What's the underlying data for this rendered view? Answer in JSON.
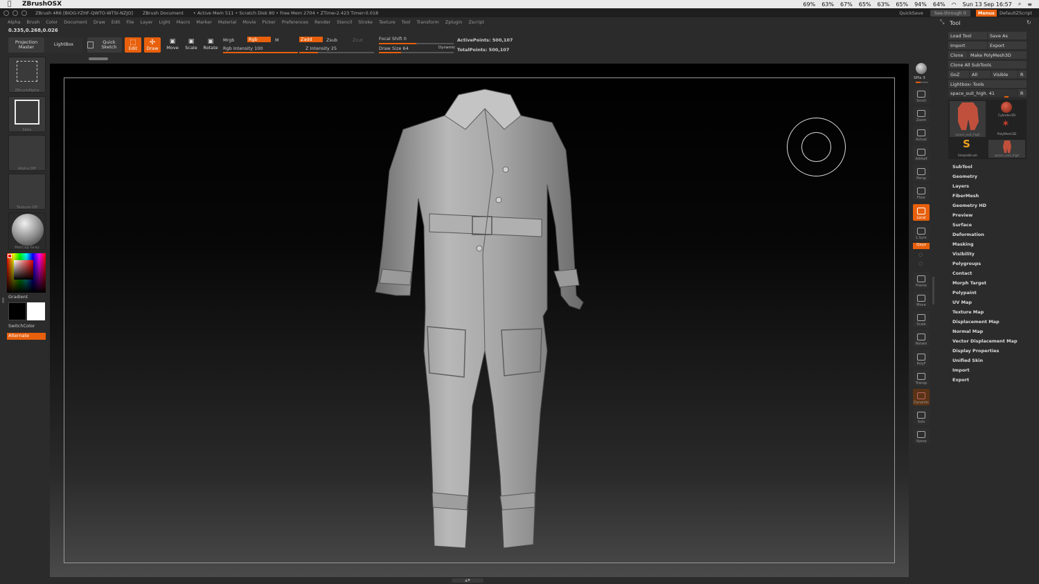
{
  "mac_menubar": {
    "app_name": "ZBrushOSX",
    "status": [
      "69%",
      "63%",
      "67%",
      "65%",
      "63%",
      "65%",
      "94%",
      "64%"
    ],
    "clock": "Sun 13 Sep 16:57"
  },
  "titlebar": {
    "version": "ZBrush 4R6 [BIOG-YZHF-QWTO-WTSI-NZJO]",
    "document": "ZBrush Document",
    "stats": "• Active Mem 511 • Scratch Disk 80 • Free Mem 2704 • ZTime›2.423 Timer›0.018",
    "quicksave": "QuickSave",
    "seethrough": "See-through  0",
    "menus": "Menus",
    "default_script": "DefaultZScript"
  },
  "menubar": [
    "Alpha",
    "Brush",
    "Color",
    "Document",
    "Draw",
    "Edit",
    "File",
    "Layer",
    "Light",
    "Macro",
    "Marker",
    "Material",
    "Movie",
    "Picker",
    "Preferences",
    "Render",
    "Stencil",
    "Stroke",
    "Texture",
    "Tool",
    "Transform",
    "Zplugin",
    "Zscript"
  ],
  "coords": "0.335,0.268,0.026",
  "toolbar": {
    "projection_master": "Projection Master",
    "lightbox": "LightBox",
    "quick_sketch": "Quick Sketch",
    "edit": "Edit",
    "draw": "Draw",
    "move": "Move",
    "scale": "Scale",
    "rotate": "Rotate",
    "mrgb": "Mrgb",
    "rgb": "Rgb",
    "m": "M",
    "zadd": "Zadd",
    "zsub": "Zsub",
    "zcut": "Zcut",
    "rgb_intensity": "Rgb Intensity 100",
    "rgb_intensity_value": 1.0,
    "z_intensity": "Z Intensity 25",
    "z_intensity_value": 0.25,
    "focal_shift": "Focal Shift 0",
    "focal_shift_value": 0.5,
    "draw_size": "Draw Size 64",
    "draw_size_value": 0.3,
    "dynamic": "Dynamic",
    "active_points": "ActivePoints: 500,107",
    "total_points": "TotalPoints: 500,107"
  },
  "left_shelf": {
    "brush_label": "ZBrushAlpha",
    "stroke_label": "Dots",
    "alpha_label": "Alpha Off",
    "texture_label": "Texture Off",
    "material_label": "MatCap Gray",
    "gradient_label": "Gradient",
    "switchcolor_label": "SwitchColor",
    "alternate_label": "Alternate"
  },
  "right_shelf": [
    {
      "name": "bpr",
      "label": "BPR"
    },
    {
      "name": "spix",
      "label": "SPix 3"
    },
    {
      "name": "scroll",
      "label": "Scroll"
    },
    {
      "name": "zoom",
      "label": "Zoom"
    },
    {
      "name": "actual",
      "label": "Actual"
    },
    {
      "name": "aahalf",
      "label": "AAHalf"
    },
    {
      "name": "persp",
      "label": "Persp"
    },
    {
      "name": "floor",
      "label": "Floor"
    },
    {
      "name": "local",
      "label": "Local"
    },
    {
      "name": "lsym",
      "label": "L.Sym"
    },
    {
      "name": "xyz",
      "label": "Qxyz"
    },
    {
      "name": "frame",
      "label": "Frame"
    },
    {
      "name": "move",
      "label": "Move"
    },
    {
      "name": "scale",
      "label": "Scale"
    },
    {
      "name": "rotate",
      "label": "Rotate"
    },
    {
      "name": "polyf",
      "label": "PolyF"
    },
    {
      "name": "transp",
      "label": "Transp"
    },
    {
      "name": "dynamic",
      "label": "Dynamic"
    },
    {
      "name": "solo",
      "label": "Solo"
    },
    {
      "name": "xpose",
      "label": "Xpose"
    }
  ],
  "tool_panel": {
    "title": "Tool",
    "load_tool": "Load Tool",
    "save_as": "Save As",
    "import": "Import",
    "export": "Export",
    "clone": "Clone",
    "make_polymesh": "Make PolyMesh3D",
    "clone_all": "Clone  All SubTools",
    "goz": "GoZ",
    "all": "All",
    "visible": "Visible",
    "r": "R",
    "lightbox_tools": "Lightbox› Tools",
    "current_tool": "space_suit_high. 41",
    "thumbs": [
      {
        "name": "space_suit_high",
        "label": "space_suit_high"
      },
      {
        "name": "cylinder3d",
        "label": "Cylinder3D"
      },
      {
        "name": "polymesh3d",
        "label": "PolyMesh3D"
      },
      {
        "name": "simplebrush",
        "label": "SimpleBrush"
      },
      {
        "name": "space_suit_high_2",
        "label": "space_suit_high"
      }
    ],
    "sections": [
      "SubTool",
      "Geometry",
      "Layers",
      "FiberMesh",
      "Geometry HD",
      "Preview",
      "Surface",
      "Deformation",
      "Masking",
      "Visibility",
      "Polygroups",
      "Contact",
      "Morph Target",
      "Polypaint",
      "UV Map",
      "Texture Map",
      "Displacement Map",
      "Normal Map",
      "Vector Displacement Map",
      "Display Properties",
      "Unified Skin",
      "Import",
      "Export"
    ]
  },
  "colors": {
    "accent": "#e8600c",
    "background": "#2b2b2b",
    "canvas_top": "#000000",
    "canvas_bottom": "#4a4a4a",
    "model": "#a8a8a8"
  }
}
